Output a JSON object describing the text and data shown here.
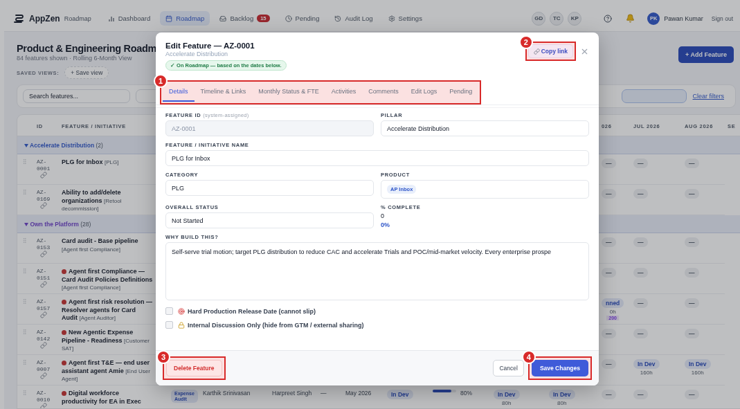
{
  "topbar": {
    "logo": "AppZen",
    "app": "Roadmap",
    "nav": [
      {
        "label": "Dashboard",
        "selected": false
      },
      {
        "label": "Roadmap",
        "selected": true
      },
      {
        "label": "Backlog",
        "selected": false,
        "badge": "15"
      },
      {
        "label": "Pending",
        "selected": false
      },
      {
        "label": "Audit Log",
        "selected": false
      },
      {
        "label": "Settings",
        "selected": false
      }
    ],
    "presence": [
      "GD",
      "TC",
      "KP"
    ],
    "user": {
      "initials": "PK",
      "name": "Pawan Kumar"
    },
    "sign_out": "Sign out"
  },
  "page": {
    "title": "Product & Engineering Roadm",
    "subtitle": "84 features shown · Rolling 6-Month View",
    "saved_views_label": "SAVED VIEWS:",
    "save_view": "+ Save view",
    "add_feature": "+ Add Feature"
  },
  "filters": {
    "search_placeholder": "Search features...",
    "clear": "Clear filters"
  },
  "table": {
    "columns": [
      "ID",
      "FEATURE / INITIATIVE",
      "026",
      "JUL 2026",
      "AUG 2026",
      "SE"
    ],
    "groups": [
      {
        "name": "Accelerate Distribution",
        "count": "(2)",
        "rows": [
          {
            "id": "AZ-0001",
            "title": "PLG for Inbox",
            "tag": "[PLG]",
            "alert": false,
            "months": [
              {
                "kind": "empty",
                "text": "—"
              },
              {
                "kind": "empty",
                "text": "—"
              },
              {
                "kind": "empty",
                "text": "—"
              }
            ]
          },
          {
            "id": "AZ-0169",
            "title": "Ability to add/delete organizations",
            "tag": "[Retool decommission]",
            "alert": false,
            "months": [
              {
                "kind": "empty",
                "text": "—"
              },
              {
                "kind": "empty",
                "text": "—"
              },
              {
                "kind": "empty",
                "text": "—"
              }
            ]
          }
        ]
      },
      {
        "name": "Own the Platform",
        "count": "(28)",
        "rows": [
          {
            "id": "AZ-0153",
            "title": "Card audit - Base pipeline",
            "tag": "[Agent first Compliance]",
            "alert": false,
            "months": [
              {
                "kind": "empty",
                "text": "—"
              },
              {
                "kind": "empty",
                "text": "—"
              },
              {
                "kind": "empty",
                "text": "—"
              }
            ]
          },
          {
            "id": "AZ-0151",
            "title": "Agent first Compliance — Card Audit Policies Definitions",
            "tag": "[Agent first Compliance]",
            "alert": true,
            "months": [
              {
                "kind": "empty",
                "text": "—"
              },
              {
                "kind": "empty",
                "text": "—"
              },
              {
                "kind": "empty",
                "text": "—"
              }
            ]
          },
          {
            "id": "AZ-0157",
            "title": "Agent first risk resolution — Resolver agents for Card Audit",
            "tag": "[Agent Auditor]",
            "alert": true,
            "months": [
              {
                "kind": "status",
                "text": "nned",
                "hours": "0h",
                "extra": "200"
              },
              {
                "kind": "empty",
                "text": "—"
              },
              {
                "kind": "empty",
                "text": "—"
              }
            ]
          },
          {
            "id": "AZ-0142",
            "title": "New Agentic Expense Pipeline - Readiness",
            "tag": "[Customer SAT]",
            "alert": true,
            "months": [
              {
                "kind": "empty",
                "text": "—"
              },
              {
                "kind": "empty",
                "text": "—"
              },
              {
                "kind": "empty",
                "text": "—"
              }
            ]
          },
          {
            "id": "AZ-0007",
            "title": "Agent first T&E — end user assistant agent Amie",
            "tag": "[End User Agent]",
            "alert": true,
            "months": [
              {
                "kind": "empty",
                "text": "—"
              },
              {
                "kind": "status",
                "text": "In Dev",
                "hours": "160h"
              },
              {
                "kind": "status",
                "text": "In Dev",
                "hours": "160h"
              }
            ]
          },
          {
            "id": "AZ-0010",
            "title": "Digital workforce productivity for EA in Exec",
            "alert": true,
            "details": {
              "product": "Expense Audit",
              "owner": "Karthik Srinivasan",
              "owner_2": "Harpreet Singh",
              "column_dash": "—",
              "date": "May 2026",
              "status": "In Dev",
              "progress": {
                "level": 0.8,
                "reading": "80%"
              }
            },
            "months": [
              {
                "kind": "status",
                "text": "In Dev",
                "hours": "80h"
              },
              {
                "kind": "status",
                "text": "In Dev",
                "hours": "80h"
              },
              {
                "kind": "empty",
                "text": "—"
              },
              {
                "kind": "empty",
                "text": "—"
              },
              {
                "kind": "empty",
                "text": "—"
              }
            ]
          }
        ]
      }
    ]
  },
  "modal": {
    "title": "Edit Feature — AZ-0001",
    "subtitle": "Accelerate Distribution",
    "status_badge": "✓ On Roadmap — based on the dates below.",
    "copy_link": {
      "label": "Copy link",
      "callout": "2"
    },
    "tabs": {
      "callout": "1",
      "items": [
        {
          "label": "Details",
          "selected": true
        },
        {
          "label": "Timeline & Links",
          "selected": false
        },
        {
          "label": "Monthly Status & FTE",
          "selected": false
        },
        {
          "label": "Activities",
          "selected": false
        },
        {
          "label": "Comments",
          "selected": false
        },
        {
          "label": "Edit Logs",
          "selected": false
        },
        {
          "label": "Pending",
          "selected": false
        }
      ]
    },
    "rows": [
      {
        "fields": [
          {
            "label": "FEATURE ID",
            "hint": "(system-assigned)",
            "kind": "readonly",
            "value": "AZ-0001"
          },
          {
            "label": "PILLAR",
            "kind": "text",
            "value": "Accelerate Distribution"
          }
        ]
      },
      {
        "fields": [
          {
            "label": "FEATURE / INITIATIVE NAME",
            "kind": "text",
            "value": "PLG for Inbox"
          }
        ]
      },
      {
        "fields": [
          {
            "label": "CATEGORY",
            "kind": "text",
            "value": "PLG"
          },
          {
            "label": "PRODUCT",
            "kind": "tags",
            "tags": [
              "AP Inbox"
            ]
          }
        ]
      },
      {
        "fields": [
          {
            "label": "OVERALL STATUS",
            "kind": "text",
            "value": "Not Started"
          },
          {
            "label": "% COMPLETE",
            "kind": "stat",
            "value": "0",
            "reading": "0%"
          }
        ]
      },
      {
        "fields": [
          {
            "label": "WHY BUILD THIS?",
            "kind": "textarea",
            "value": "Self-serve trial motion; target PLG distribution to reduce CAC and accelerate Trials and POC/mid-market velocity.  Every enterprise prospe"
          }
        ]
      }
    ],
    "checkboxes": [
      {
        "label": "Hard Production Release Date (cannot slip)",
        "checked": false
      },
      {
        "label": "Internal Discussion Only (hide from GTM / external sharing)",
        "checked": false
      }
    ],
    "footer": {
      "delete": {
        "label": "Delete Feature",
        "callout": "3"
      },
      "cancel": "Cancel",
      "save": {
        "label": "Save Changes",
        "callout": "4"
      }
    }
  }
}
